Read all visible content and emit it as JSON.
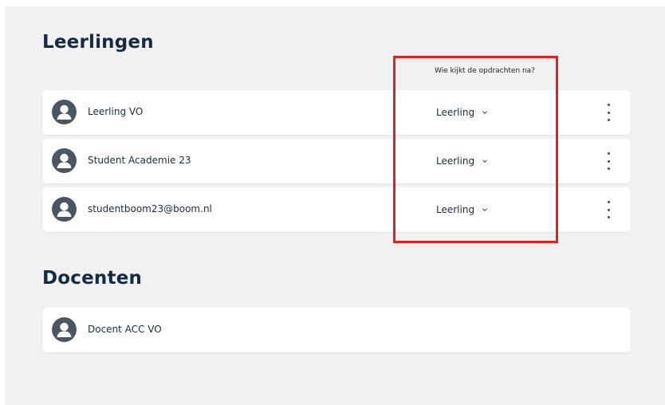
{
  "sections": {
    "students_title": "Leerlingen",
    "teachers_title": "Docenten"
  },
  "column_header": "Wie kijkt de opdrachten na?",
  "students": [
    {
      "name": "Leerling VO",
      "role": "Leerling"
    },
    {
      "name": "Student Academie 23",
      "role": "Leerling"
    },
    {
      "name": "studentboom23@boom.nl",
      "role": "Leerling"
    }
  ],
  "teachers": [
    {
      "name": "Docent ACC VO"
    }
  ],
  "icons": {
    "avatar": "user-avatar-icon",
    "dropdown": "chevron-down-icon",
    "menu": "kebab-menu-icon"
  },
  "colors": {
    "highlight": "#e32020",
    "avatar": "#4b5662",
    "title": "#152a44"
  }
}
